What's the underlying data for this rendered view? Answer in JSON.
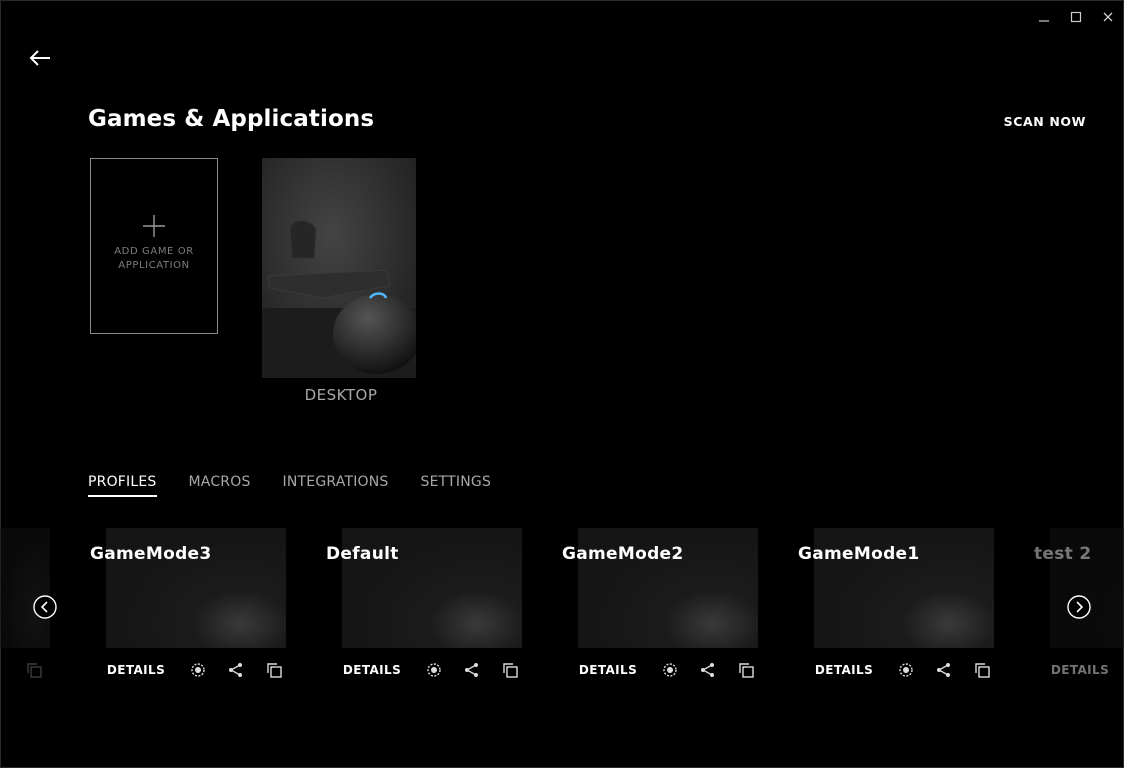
{
  "window": {
    "controls": [
      {
        "name": "minimize-icon",
        "glyph": "minimize"
      },
      {
        "name": "maximize-icon",
        "glyph": "maximize"
      },
      {
        "name": "close-icon",
        "glyph": "close"
      }
    ]
  },
  "header": {
    "title": "Games & Applications",
    "scan_label": "SCAN NOW",
    "back_icon": "arrow-left-icon"
  },
  "apps": {
    "add_label": "ADD GAME OR APPLICATION",
    "desktop_label": "DESKTOP"
  },
  "tabs": [
    {
      "label": "PROFILES",
      "active": true
    },
    {
      "label": "MACROS",
      "active": false
    },
    {
      "label": "INTEGRATIONS",
      "active": false
    },
    {
      "label": "SETTINGS",
      "active": false
    }
  ],
  "profiles": [
    {
      "name": "GameMode3",
      "details_label": "DETAILS"
    },
    {
      "name": "Default",
      "details_label": "DETAILS"
    },
    {
      "name": "GameMode2",
      "details_label": "DETAILS"
    },
    {
      "name": "GameMode1",
      "details_label": "DETAILS"
    },
    {
      "name": "test 2",
      "details_label": "DETAILS"
    }
  ],
  "action_icons": [
    "persistent-icon",
    "share-icon",
    "copy-icon"
  ],
  "nav": {
    "prev_icon": "chevron-left-circle-icon",
    "next_icon": "chevron-right-circle-icon"
  },
  "colors": {
    "background": "#000000",
    "text": "#ffffff",
    "muted": "#a8a8a8",
    "accent_led": "#4fb8ff"
  }
}
